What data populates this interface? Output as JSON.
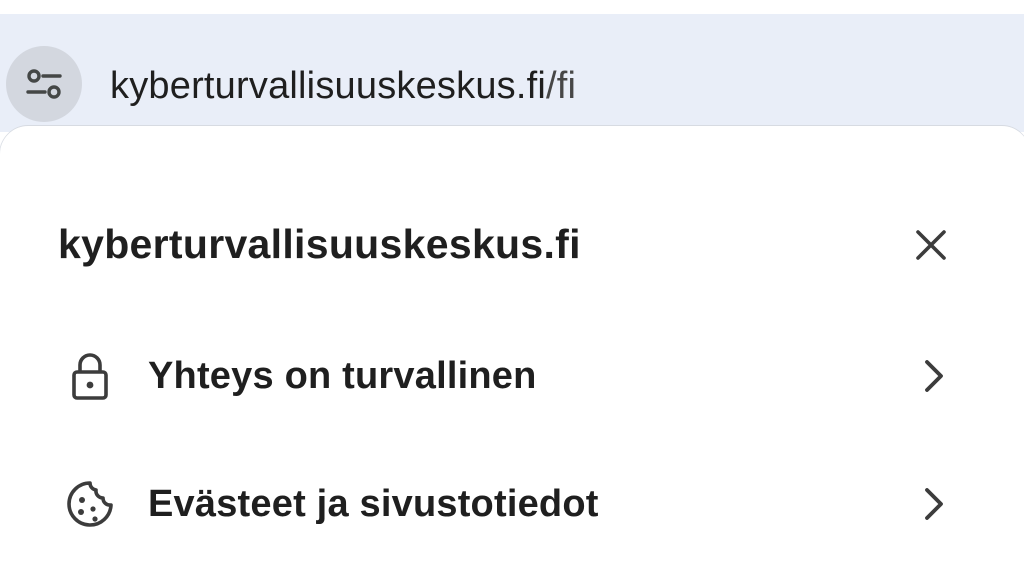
{
  "omnibox": {
    "host": "kyberturvallisuuskeskus.fi",
    "path": "/fi",
    "site_settings_icon": "tune-icon"
  },
  "popup": {
    "title": "kyberturvallisuuskeskus.fi",
    "close_icon": "close-icon",
    "rows": [
      {
        "label": "Yhteys on turvallinen",
        "icon": "lock-icon"
      },
      {
        "label": "Evästeet ja sivustotiedot",
        "icon": "cookie-icon"
      }
    ]
  }
}
